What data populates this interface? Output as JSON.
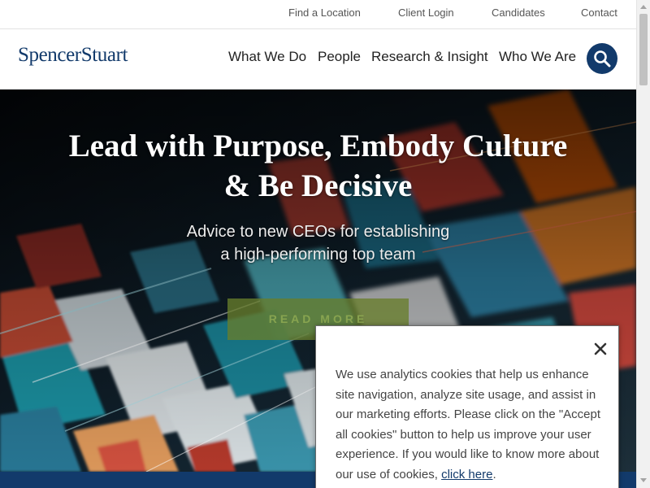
{
  "utility_nav": {
    "items": [
      {
        "label": "Find a Location"
      },
      {
        "label": "Client Login"
      },
      {
        "label": "Candidates"
      },
      {
        "label": "Contact"
      }
    ]
  },
  "header": {
    "logo_text": "SpencerStuart",
    "nav": [
      {
        "label": "What We Do"
      },
      {
        "label": "People"
      },
      {
        "label": "Research & Insight"
      },
      {
        "label": "Who We Are"
      }
    ],
    "search_icon": "search-icon"
  },
  "hero": {
    "title_line1": "Lead with Purpose, Embody Culture",
    "title_line2": "& Be Decisive",
    "subtitle_line1": "Advice to new CEOs for establishing",
    "subtitle_line2": "a high-performing top team",
    "cta_label": "READ MORE"
  },
  "cookie_banner": {
    "close_icon": "close-icon",
    "text": "We use analytics cookies that help us enhance site navigation, analyze site usage, and assist in our marketing efforts. Please click on the \"Accept all cookies\" button to help us improve your user experience. If you would like to know more about our use of cookies, ",
    "link_label": "click here",
    "text_end": "."
  },
  "colors": {
    "brand_navy": "#123a6b",
    "cta_green": "#687e2c"
  }
}
